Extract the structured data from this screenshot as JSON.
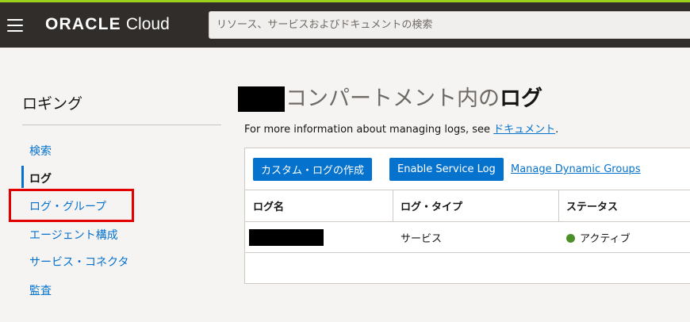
{
  "header": {
    "brand_bold": "ORACLE",
    "brand_rest": "Cloud",
    "search_placeholder": "リソース、サービスおよびドキュメントの検索"
  },
  "sidebar": {
    "title": "ロギング",
    "items": [
      {
        "label": "検索",
        "active": false
      },
      {
        "label": "ログ",
        "active": true
      },
      {
        "label": "ログ・グループ",
        "active": false,
        "highlighted": true
      },
      {
        "label": "エージェント構成",
        "active": false
      },
      {
        "label": "サービス・コネクタ",
        "active": false
      },
      {
        "label": "監査",
        "active": false
      }
    ]
  },
  "main": {
    "title_light": "コンパートメント内の",
    "title_bold": "ログ",
    "info_text": "For more information about managing logs, see ",
    "info_link": "ドキュメント",
    "info_end": ".",
    "buttons": {
      "create_log": "カスタム・ログの作成",
      "enable_service_log": "Enable Service Log",
      "manage_dynamic_groups": "Manage Dynamic Groups"
    },
    "table": {
      "columns": [
        "ログ名",
        "ログ・タイプ",
        "ステータス"
      ],
      "rows": [
        {
          "name": "",
          "type": "サービス",
          "status": "アクティブ"
        }
      ]
    }
  },
  "colors": {
    "accent": "#0572ce",
    "header_bg": "#312d2a",
    "status_active": "#4b8f29",
    "highlight": "#e20000"
  }
}
